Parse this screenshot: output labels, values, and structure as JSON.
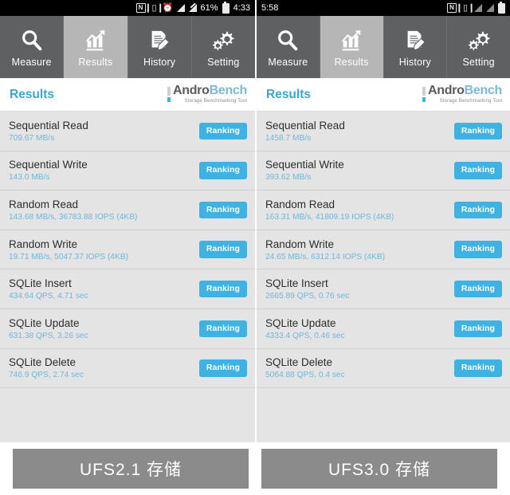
{
  "phones": [
    {
      "id": "left",
      "statusbar": {
        "time": "4:33",
        "battery_pct": "61%",
        "icons": [
          "nfc-icon",
          "vibrate-icon",
          "alarm-icon",
          "signal-icon",
          "signal-cross-icon",
          "battery-icon"
        ]
      },
      "tabs": [
        {
          "label": "Measure",
          "icon": "magnifier-icon",
          "active": false
        },
        {
          "label": "Results",
          "icon": "bar-chart-icon",
          "active": true
        },
        {
          "label": "History",
          "icon": "document-pencil-icon",
          "active": false
        },
        {
          "label": "Setting",
          "icon": "gears-icon",
          "active": false
        }
      ],
      "header": {
        "title": "Results",
        "logo_andro": "Andro",
        "logo_bench": "Bench",
        "logo_sub": "Storage Benchmarking Tool"
      },
      "rows": [
        {
          "name": "Sequential Read",
          "value": "709.67 MB/s",
          "button": "Ranking"
        },
        {
          "name": "Sequential Write",
          "value": "143.0 MB/s",
          "button": "Ranking"
        },
        {
          "name": "Random Read",
          "value": "143.68 MB/s, 36783.88 IOPS (4KB)",
          "button": "Ranking"
        },
        {
          "name": "Random Write",
          "value": "19.71 MB/s, 5047.37 IOPS (4KB)",
          "button": "Ranking"
        },
        {
          "name": "SQLite Insert",
          "value": "434.64 QPS, 4.71 sec",
          "button": "Ranking"
        },
        {
          "name": "SQLite Update",
          "value": "631.38 QPS, 3.26 sec",
          "button": "Ranking"
        },
        {
          "name": "SQLite Delete",
          "value": "746.9 QPS, 2.74 sec",
          "button": "Ranking"
        }
      ],
      "caption": "UFS2.1 存储"
    },
    {
      "id": "right",
      "statusbar": {
        "time": "5:58",
        "battery_pct": "",
        "icons": [
          "nfc-icon",
          "vibrate-icon",
          "signal-icon",
          "signal-icon",
          "battery-icon"
        ]
      },
      "tabs": [
        {
          "label": "Measure",
          "icon": "magnifier-icon",
          "active": false
        },
        {
          "label": "Results",
          "icon": "bar-chart-icon",
          "active": true
        },
        {
          "label": "History",
          "icon": "document-pencil-icon",
          "active": false
        },
        {
          "label": "Setting",
          "icon": "gears-icon",
          "active": false
        }
      ],
      "header": {
        "title": "Results",
        "logo_andro": "Andro",
        "logo_bench": "Bench",
        "logo_sub": "Storage Benchmarking Tool"
      },
      "rows": [
        {
          "name": "Sequential Read",
          "value": "1458.7 MB/s",
          "button": "Ranking"
        },
        {
          "name": "Sequential Write",
          "value": "393.62 MB/s",
          "button": "Ranking"
        },
        {
          "name": "Random Read",
          "value": "163.31 MB/s, 41809.19 IOPS (4KB)",
          "button": "Ranking"
        },
        {
          "name": "Random Write",
          "value": "24.65 MB/s, 6312.14 IOPS (4KB)",
          "button": "Ranking"
        },
        {
          "name": "SQLite Insert",
          "value": "2665.89 QPS, 0.76 sec",
          "button": "Ranking"
        },
        {
          "name": "SQLite Update",
          "value": "4333.4 QPS, 0.46 sec",
          "button": "Ranking"
        },
        {
          "name": "SQLite Delete",
          "value": "5064.88 QPS, 0.4 sec",
          "button": "Ranking"
        }
      ],
      "caption": "UFS3.0 存储"
    }
  ],
  "colors": {
    "accent_blue": "#3db2e3",
    "value_blue": "#6fb6db",
    "tabbar_gray": "#5f6062",
    "tab_active_gray": "#b6b6b6",
    "page_gray": "#e4e4e4",
    "caption_gray": "#8b8b8b"
  }
}
